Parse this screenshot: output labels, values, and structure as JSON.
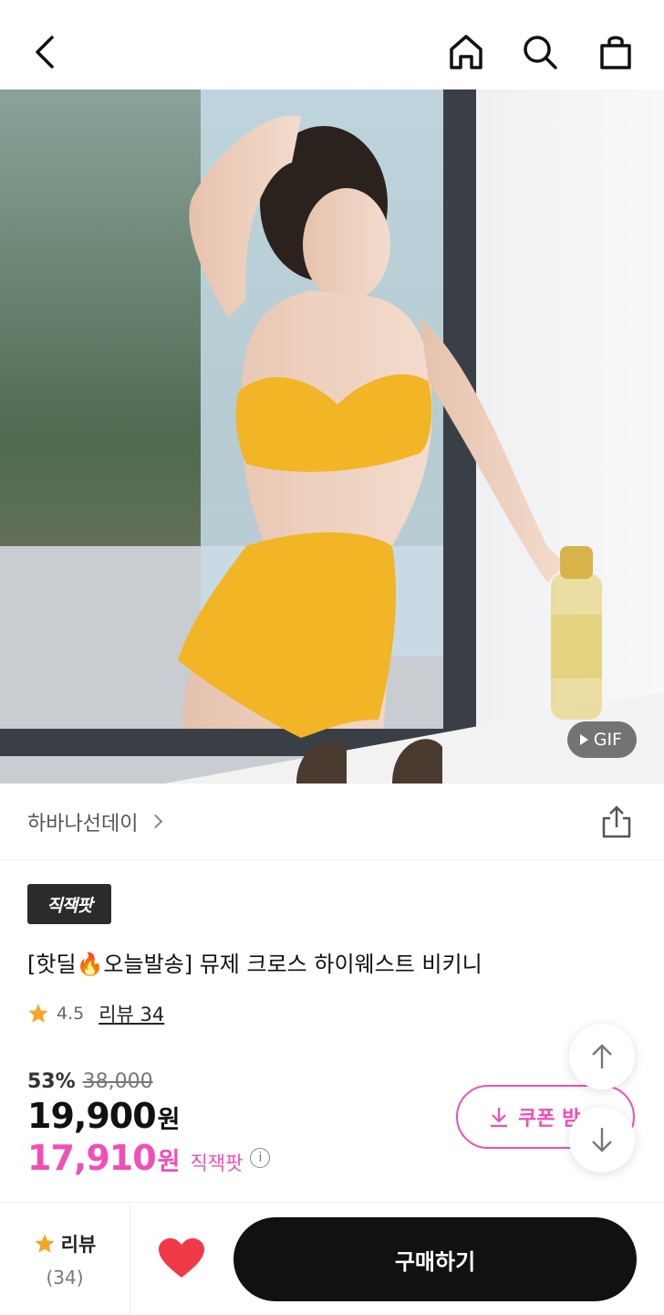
{
  "nav": {
    "back_icon": "chevron-left-icon",
    "home_icon": "home-icon",
    "search_icon": "search-icon",
    "cart_icon": "shopping-bag-icon"
  },
  "hero": {
    "gif_label": "GIF"
  },
  "brand": {
    "name": "하바나선데이"
  },
  "product": {
    "badge": "직잭팟",
    "title": "[핫딜🔥오늘발송] 뮤제 크로스 하이웨스트 비키니",
    "rating": "4.5",
    "review_link": "리뷰 34",
    "discount": "53%",
    "original_price": "38,000",
    "price": "19,900",
    "currency": "원",
    "special_price": "17,910",
    "special_label": "직잭팟",
    "coupon_label": "쿠폰 받"
  },
  "bottom": {
    "review_label": "리뷰",
    "review_count": "(34)",
    "buy_label": "구매하기"
  },
  "colors": {
    "accent_pink": "#f04fb6",
    "star_orange": "#f5a623",
    "heart_red": "#f03a47"
  }
}
